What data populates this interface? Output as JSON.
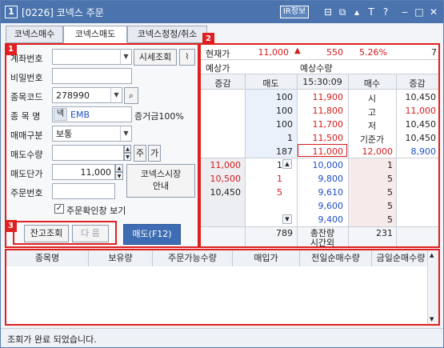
{
  "window": {
    "number": "1",
    "title": "[0226] 코넥스 주문",
    "ir_button": "IR정보"
  },
  "tabs": [
    {
      "label": "코넥스매수"
    },
    {
      "label": "코넥스매도"
    },
    {
      "label": "코넥스정정/취소"
    }
  ],
  "annotations": {
    "n1": "1",
    "n2": "2",
    "n3": "3"
  },
  "order_form": {
    "account_label": "계좌번호",
    "account_value": "",
    "price_lookup_button": "시세조회",
    "password_label": "비밀번호",
    "password_value": "",
    "code_label": "종목코드",
    "code_value": "278990",
    "name_label": "종 목 명",
    "name_badge": "넥",
    "name_value": "EMB",
    "margin_value": "증거금100%",
    "trade_type_label": "매매구분",
    "trade_type_value": "보통",
    "qty_label": "매도수량",
    "qty_value": "",
    "qty_share_btn": "주",
    "qty_price_btn": "가",
    "price_label": "매도단가",
    "price_value": "11,000",
    "market_guide_button": "코넥스시장\n안내",
    "order_no_label": "주문번호",
    "order_no_value": "",
    "confirm_checkbox_label": "주문확인창 보기",
    "confirm_checked": true,
    "balance_button": "잔고조회",
    "next_button": "다 음",
    "sell_button": "매도(F12)"
  },
  "quote": {
    "current_price_label": "현재가",
    "current_price": "11,000",
    "change": "550",
    "change_pct": "5.26%",
    "volume": "7",
    "expected_price_label": "예상가",
    "expected_qty_label": "예상수량",
    "headers": [
      "증감",
      "매도",
      "15:30:09",
      "매수",
      "증감"
    ],
    "ask_rows": [
      {
        "qty": "100",
        "price": "11,900",
        "info_label": "시",
        "info_value": "10,450"
      },
      {
        "qty": "100",
        "price": "11,800",
        "info_label": "고",
        "info_value": "11,000"
      },
      {
        "qty": "100",
        "price": "11,700",
        "info_label": "저",
        "info_value": "10,450"
      },
      {
        "qty": "1",
        "price": "11,500",
        "info_label": "기준가",
        "info_value": "10,450"
      },
      {
        "qty": "187",
        "price": "11,000",
        "info_label": "12,000",
        "info_value": "8,900"
      }
    ],
    "bid_rows": [
      {
        "side": "11,000",
        "side_qty": "1",
        "price": "10,000",
        "qty": "1"
      },
      {
        "side": "10,500",
        "side_qty": "1",
        "price": "9,800",
        "qty": "5"
      },
      {
        "side": "10,450",
        "side_qty": "5",
        "price": "9,610",
        "qty": "5"
      },
      {
        "side": "",
        "side_qty": "",
        "price": "9,600",
        "qty": "5"
      },
      {
        "side": "",
        "side_qty": "",
        "price": "9,400",
        "qty": "5"
      }
    ],
    "total_ask": "789",
    "total_label": "총잔량",
    "after_hours_label": "시간외",
    "total_bid": "231"
  },
  "holdings_table": {
    "columns": [
      "종목명",
      "보유량",
      "주문가능수량",
      "매입가",
      "전일순매수량",
      "금일순매수량"
    ]
  },
  "status_bar": {
    "message": "조회가 완료 되었습니다."
  }
}
